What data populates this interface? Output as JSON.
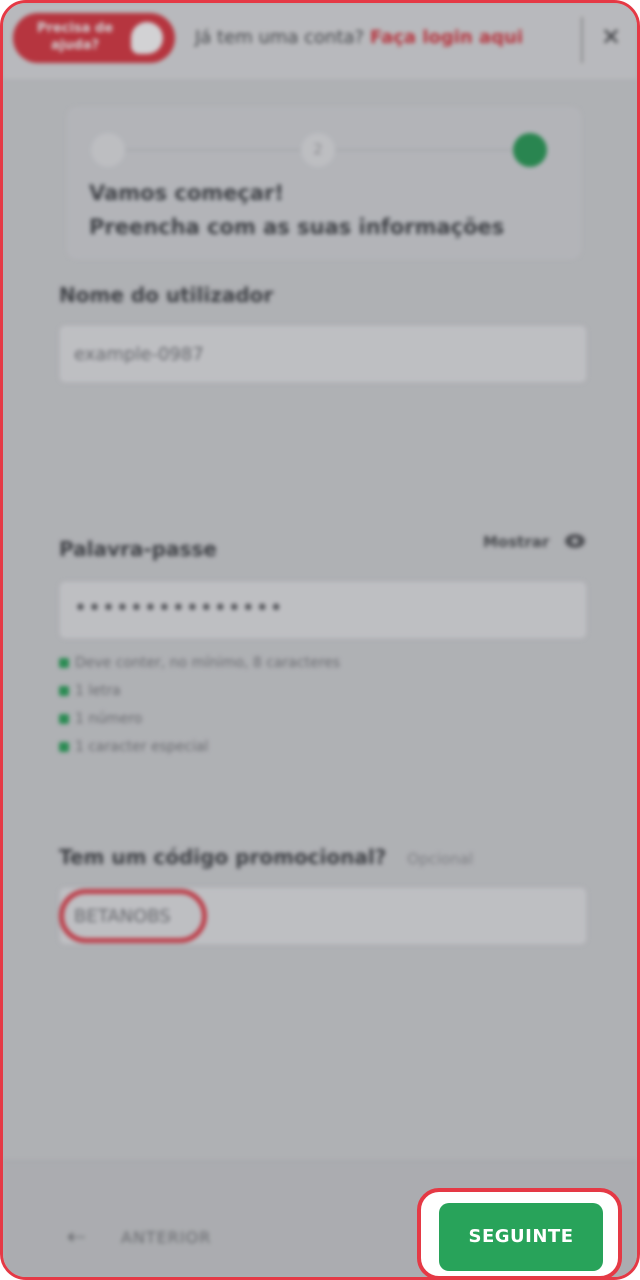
{
  "header": {
    "help_label": "Precisa de\najuda?",
    "login_prompt": "Já tem uma conta?",
    "login_link": "Faça login aqui",
    "close_glyph": "✕"
  },
  "steps": {
    "step2_number": "2",
    "title": "Vamos começar!",
    "subtitle": "Preencha com as suas informações"
  },
  "username": {
    "label": "Nome do utilizador",
    "value": "example-0987"
  },
  "password": {
    "label": "Palavra-passe",
    "show_label": "Mostrar",
    "value_mask": "•••••••••••••••",
    "rules": [
      "Deve conter, no mínimo, 8 caracteres",
      "1 letra",
      "1 número",
      "1 caracter especial"
    ]
  },
  "promo": {
    "label": "Tem um código promocional?",
    "optional": "Opcional",
    "value": "BETANOBS"
  },
  "footer": {
    "back_glyph": "⇠",
    "back_label": "ANTERIOR",
    "next_label": "SEGUINTE"
  },
  "colors": {
    "accent_red": "#d92631",
    "success_green": "#1f9b4f",
    "highlight_red": "#e53945"
  }
}
